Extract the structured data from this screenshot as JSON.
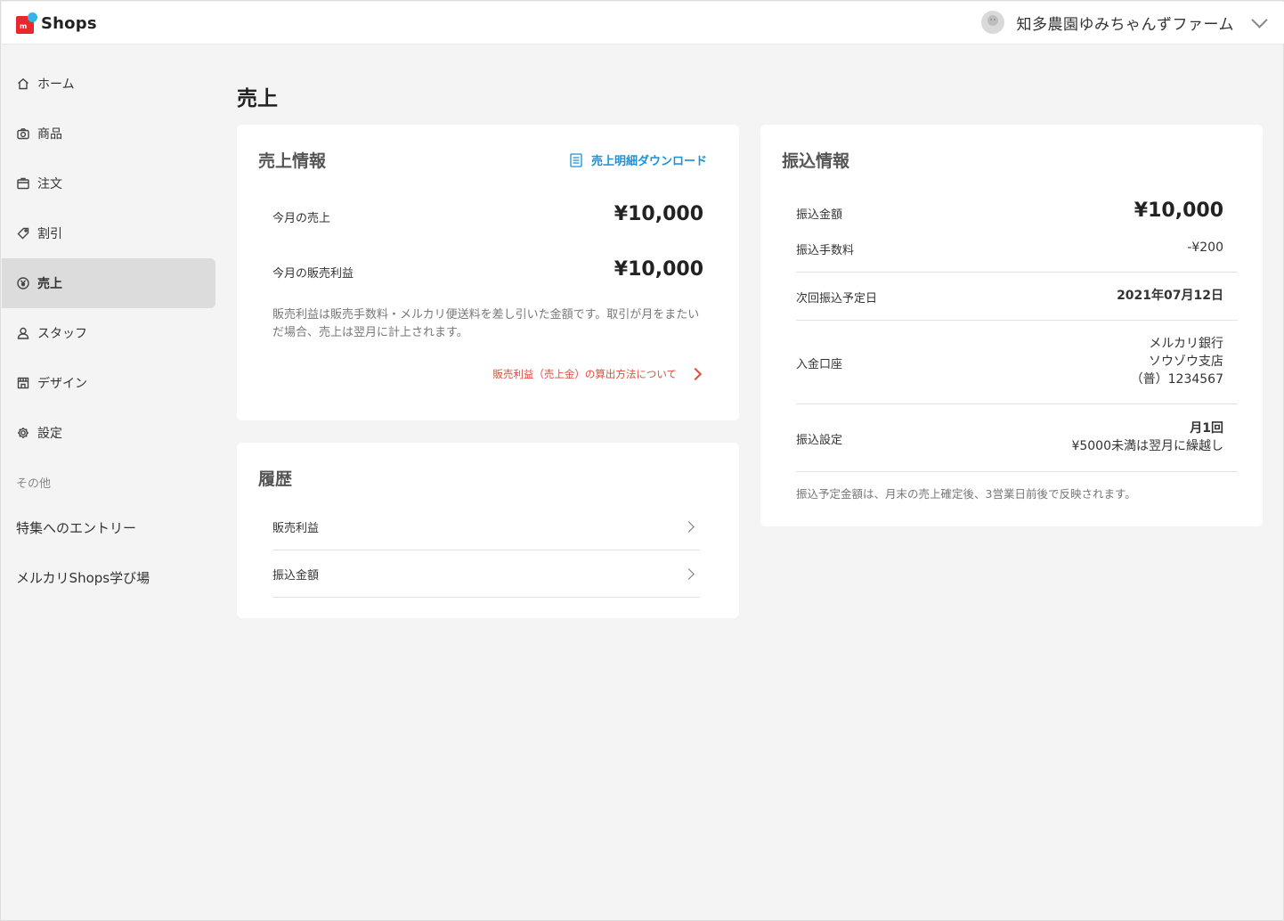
{
  "header": {
    "logo_mark_letter": "m",
    "logo_text": "Shops",
    "account_name": "知多農園ゆみちゃんずファーム"
  },
  "sidebar": {
    "items": [
      {
        "label": "ホーム",
        "icon": "home-icon"
      },
      {
        "label": "商品",
        "icon": "camera-icon"
      },
      {
        "label": "注文",
        "icon": "box-icon"
      },
      {
        "label": "割引",
        "icon": "tag-icon"
      },
      {
        "label": "売上",
        "icon": "yen-icon",
        "active": true
      },
      {
        "label": "スタッフ",
        "icon": "person-icon"
      },
      {
        "label": "デザイン",
        "icon": "store-icon"
      },
      {
        "label": "設定",
        "icon": "gear-icon"
      }
    ],
    "section_label": "その他",
    "extra_links": [
      "特集へのエントリー",
      "メルカリShops学び場"
    ]
  },
  "page": {
    "title": "売上"
  },
  "sales_card": {
    "title": "売上情報",
    "download_label": "売上明細ダウンロード",
    "month_sales_label": "今月の売上",
    "month_sales_value": "¥10,000",
    "month_profit_label": "今月の販売利益",
    "month_profit_value": "¥10,000",
    "note": "販売利益は販売手数料・メルカリ便送料を差し引いた金額です。取引が月をまたいだ場合、売上は翌月に計上されます。",
    "calc_link": "販売利益（売上金）の算出方法について"
  },
  "history_card": {
    "title": "履歴",
    "rows": [
      "販売利益",
      "振込金額"
    ]
  },
  "transfer_card": {
    "title": "振込情報",
    "amount_label": "振込金額",
    "amount_value": "¥10,000",
    "fee_label": "振込手数料",
    "fee_value": "-¥200",
    "next_date_label": "次回振込予定日",
    "next_date_value": "2021年07月12日",
    "account_label": "入金口座",
    "bank_name": "メルカリ銀行",
    "branch_name": "ソウゾウ支店",
    "account_number": "（普）1234567",
    "setting_label": "振込設定",
    "setting_value": "月1回",
    "setting_note": "¥5000未満は翌月に繰越し",
    "footer_note": "振込予定金額は、月末の売上確定後、3営業日前後で反映されます。"
  },
  "colors": {
    "accent_blue": "#1a92d6",
    "accent_red": "#e04b3a",
    "brand_red": "#e8272e",
    "brand_blue": "#2fb5e8",
    "background": "#f4f4f4"
  }
}
